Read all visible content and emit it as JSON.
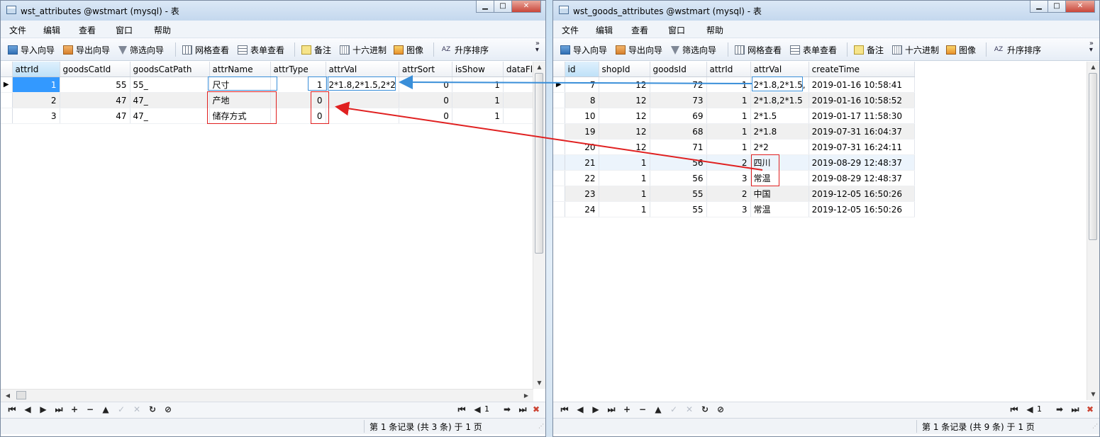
{
  "left": {
    "title": "wst_attributes @wstmart (mysql) - 表",
    "menu": [
      "文件",
      "编辑",
      "查看",
      "窗口",
      "帮助"
    ],
    "toolbar": [
      "导入向导",
      "导出向导",
      "筛选向导",
      "网格查看",
      "表单查看",
      "备注",
      "十六进制",
      "图像",
      "升序排序"
    ],
    "columns": [
      "attrId",
      "goodsCatId",
      "goodsCatPath",
      "attrName",
      "attrType",
      "attrVal",
      "attrSort",
      "isShow",
      "dataFla"
    ],
    "rows": [
      [
        "1",
        "55",
        "55_",
        "尺寸",
        "1",
        "2*1.8,2*1.5,2*2",
        "0",
        "1",
        ""
      ],
      [
        "2",
        "47",
        "47_",
        "产地",
        "0",
        "",
        "0",
        "1",
        ""
      ],
      [
        "3",
        "47",
        "47_",
        "储存方式",
        "0",
        "",
        "0",
        "1",
        ""
      ]
    ],
    "page": "1",
    "status": "第 1 条记录 (共 3 条) 于 1 页"
  },
  "right": {
    "title": "wst_goods_attributes @wstmart (mysql) - 表",
    "menu": [
      "文件",
      "编辑",
      "查看",
      "窗口",
      "帮助"
    ],
    "toolbar": [
      "导入向导",
      "导出向导",
      "筛选向导",
      "网格查看",
      "表单查看",
      "备注",
      "十六进制",
      "图像",
      "升序排序"
    ],
    "columns": [
      "id",
      "shopId",
      "goodsId",
      "attrId",
      "attrVal",
      "createTime"
    ],
    "rows": [
      [
        "7",
        "12",
        "72",
        "1",
        "2*1.8,2*1.5,",
        "2019-01-16 10:58:41"
      ],
      [
        "8",
        "12",
        "73",
        "1",
        "2*1.8,2*1.5",
        "2019-01-16 10:58:52"
      ],
      [
        "10",
        "12",
        "69",
        "1",
        "2*1.5",
        "2019-01-17 11:58:30"
      ],
      [
        "19",
        "12",
        "68",
        "1",
        "2*1.8",
        "2019-07-31 16:04:37"
      ],
      [
        "20",
        "12",
        "71",
        "1",
        "2*2",
        "2019-07-31 16:24:11"
      ],
      [
        "21",
        "1",
        "56",
        "2",
        "四川",
        "2019-08-29 12:48:37"
      ],
      [
        "22",
        "1",
        "56",
        "3",
        "常温",
        "2019-08-29 12:48:37"
      ],
      [
        "23",
        "1",
        "55",
        "2",
        "中国",
        "2019-12-05 16:50:26"
      ],
      [
        "24",
        "1",
        "55",
        "3",
        "常温",
        "2019-12-05 16:50:26"
      ]
    ],
    "page": "1",
    "status": "第 1 条记录 (共 9 条) 于 1 页"
  },
  "colors": {
    "selection": "#3399ff",
    "annotation_red": "#e02020",
    "annotation_blue": "#3a8fd9"
  }
}
